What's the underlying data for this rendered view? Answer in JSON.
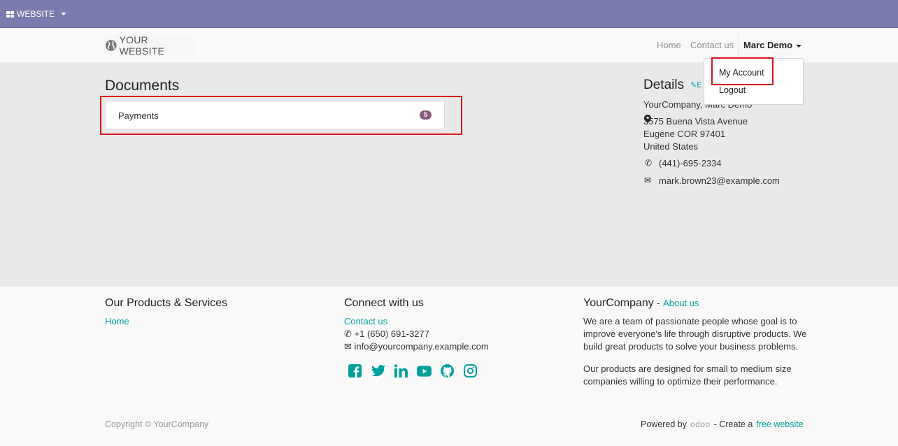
{
  "admin_bar": {
    "app_label": "WEBSITE"
  },
  "header": {
    "logo_text": "YOUR WEBSITE",
    "nav": {
      "home": "Home",
      "contact": "Contact us",
      "user": "Marc Demo"
    }
  },
  "user_menu": {
    "my_account": "My Account",
    "logout": "Logout"
  },
  "documents": {
    "title": "Documents",
    "items": [
      {
        "label": "Payments",
        "count": "5"
      }
    ]
  },
  "details": {
    "title": "Details",
    "edit_label": "E",
    "company_name": "YourCompany, Marc Demo",
    "street": "3575 Buena Vista Avenue",
    "city_line": "Eugene COR 97401",
    "country": "United States",
    "phone": "(441)-695-2334",
    "email": "mark.brown23@example.com"
  },
  "footer": {
    "products": {
      "title": "Our Products & Services",
      "home_link": "Home"
    },
    "connect": {
      "title": "Connect with us",
      "contact_link": "Contact us",
      "phone": "+1 (650) 691-3277",
      "email": "info@yourcompany.example.com",
      "social_icons": [
        "facebook-icon",
        "twitter-icon",
        "linkedin-icon",
        "youtube-icon",
        "github-icon",
        "instagram-icon"
      ]
    },
    "company": {
      "title": "YourCompany",
      "separator": "-",
      "about_link": "About us",
      "para1_l1": "We are a team of passionate people whose goal is to",
      "para1_l2": "improve everyone's life through disruptive products. We",
      "para1_l3": "build great products to solve your business problems.",
      "para2_l1": "Our products are designed for small to medium size",
      "para2_l2": "companies willing to optimize their performance."
    },
    "copyright": "Copyright © YourCompany",
    "powered_by": "Powered by",
    "odoo_text": "odoo",
    "create_a": "- Create a",
    "free_website_link": "free website"
  },
  "colors": {
    "accent": "#00a09d",
    "admin_bar": "#7c7bad",
    "badge": "#875a7b",
    "highlight": "#d9151b"
  }
}
